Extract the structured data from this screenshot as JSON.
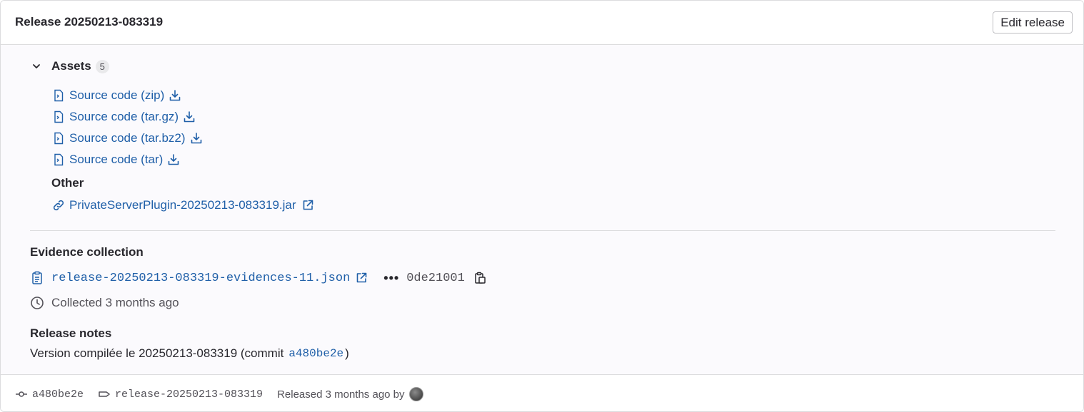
{
  "header": {
    "title": "Release 20250213-083319",
    "edit_label": "Edit release"
  },
  "assets": {
    "label": "Assets",
    "count": "5",
    "sources": [
      {
        "label": "Source code (zip)"
      },
      {
        "label": "Source code (tar.gz)"
      },
      {
        "label": "Source code (tar.bz2)"
      },
      {
        "label": "Source code (tar)"
      }
    ],
    "other_label": "Other",
    "other_link": "PrivateServerPlugin-20250213-083319.jar"
  },
  "evidence": {
    "title": "Evidence collection",
    "file": "release-20250213-083319-evidences-11.json",
    "sha": "0de21001",
    "collected": "Collected 3 months ago"
  },
  "notes": {
    "title": "Release notes",
    "text_before": "Version compilée le 20250213-083319 (commit",
    "commit": "a480be2e",
    "text_after": ")"
  },
  "footer": {
    "commit": "a480be2e",
    "tag": "release-20250213-083319",
    "released": "Released 3 months ago by"
  },
  "colors": {
    "link": "#1f5fa8",
    "border": "#dcdcde",
    "body_bg": "#fbfafd"
  }
}
